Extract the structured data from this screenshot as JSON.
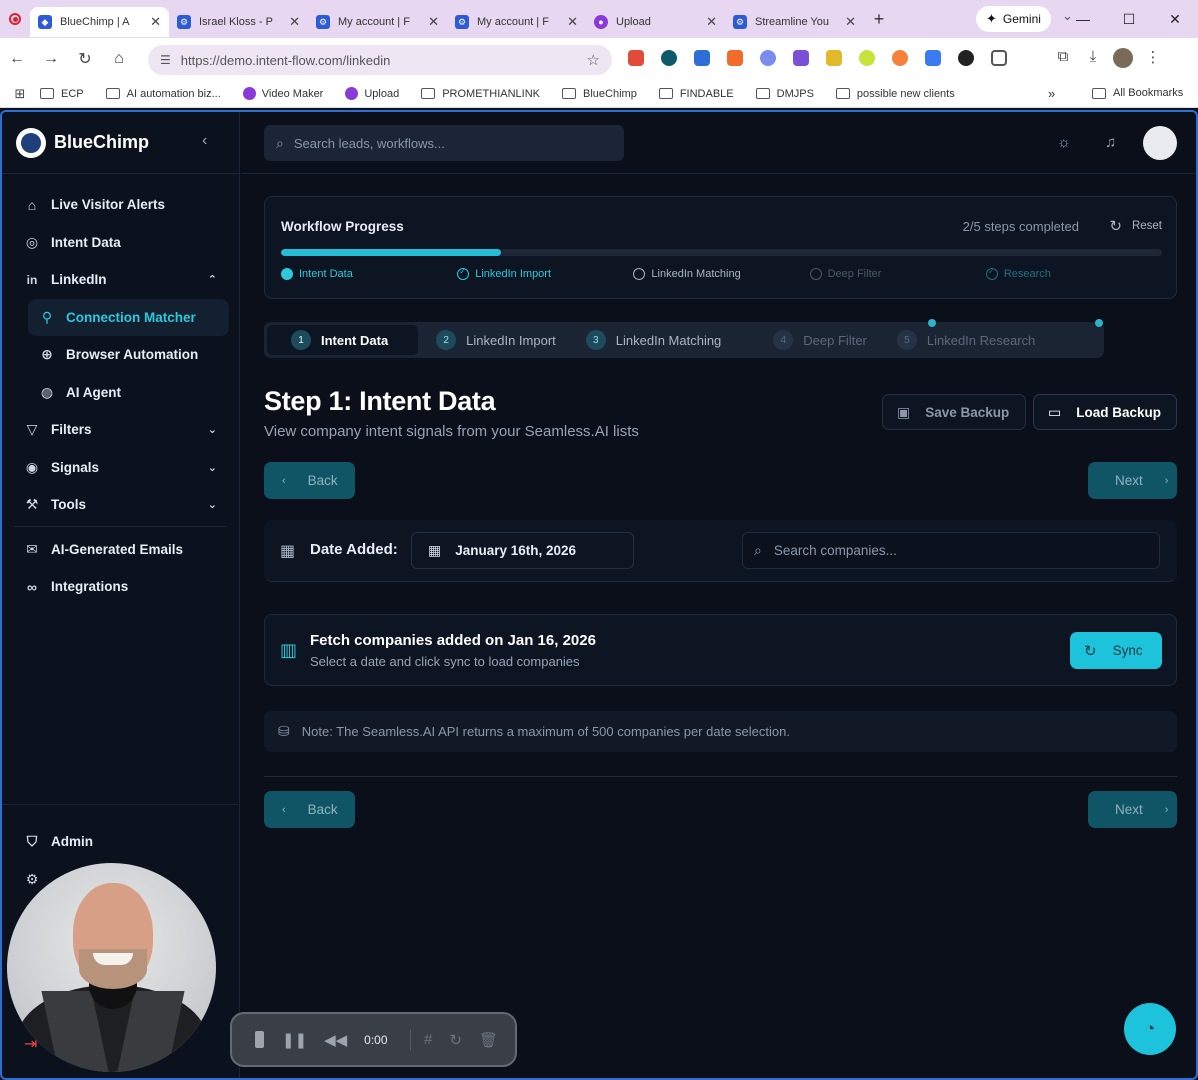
{
  "browser": {
    "tabs": [
      {
        "title": "BlueChimp | A",
        "active": true
      },
      {
        "title": "Israel Kloss - P",
        "active": false
      },
      {
        "title": "My account | F",
        "active": false
      },
      {
        "title": "My account | F",
        "active": false
      },
      {
        "title": "Upload",
        "active": false
      },
      {
        "title": "Streamline You",
        "active": false
      }
    ],
    "gemini_label": "Gemini",
    "url": "https://demo.intent-flow.com/linkedin",
    "bookmarks": [
      "ECP",
      "AI automation biz...",
      "Video Maker",
      "Upload",
      "PROMETHIANLINK",
      "BlueChimp",
      "FINDABLE",
      "DMJPS",
      "possible new clients"
    ],
    "all_bookmarks": "All Bookmarks"
  },
  "app": {
    "brand": "BlueChimp",
    "search_placeholder": "Search leads, workflows...",
    "nav": [
      {
        "label": "Live Visitor Alerts",
        "icon": "home-icon"
      },
      {
        "label": "Intent Data",
        "icon": "target-icon"
      },
      {
        "label": "LinkedIn",
        "icon": "linkedin-icon"
      },
      {
        "label": "Connection Matcher",
        "icon": "network-icon"
      },
      {
        "label": "Browser Automation",
        "icon": "globe-icon"
      },
      {
        "label": "AI Agent",
        "icon": "bot-icon"
      },
      {
        "label": "Filters",
        "icon": "filter-icon"
      },
      {
        "label": "Signals",
        "icon": "signal-icon"
      },
      {
        "label": "Tools",
        "icon": "wrench-icon"
      },
      {
        "label": "AI-Generated Emails",
        "icon": "mail-icon"
      },
      {
        "label": "Integrations",
        "icon": "link-icon"
      }
    ],
    "bottom_nav": [
      {
        "label": "Admin",
        "icon": "shield-icon"
      }
    ]
  },
  "workflow": {
    "title": "Workflow Progress",
    "steps_completed": "2/5 steps completed",
    "reset_label": "Reset",
    "progress_fraction": 0.25,
    "progress_steps": [
      "Intent Data",
      "LinkedIn Import",
      "LinkedIn Matching",
      "Deep Filter",
      "Research"
    ],
    "step_tabs": [
      {
        "num": "1",
        "label": "Intent Data"
      },
      {
        "num": "2",
        "label": "LinkedIn Import"
      },
      {
        "num": "3",
        "label": "LinkedIn Matching"
      },
      {
        "num": "4",
        "label": "Deep Filter"
      },
      {
        "num": "5",
        "label": "LinkedIn Research"
      }
    ]
  },
  "step": {
    "title": "Step 1: Intent Data",
    "subtitle": "View company intent signals from your Seamless.AI lists",
    "save_backup": "Save Backup",
    "load_backup": "Load Backup",
    "back": "Back",
    "next": "Next",
    "date_label": "Date Added:",
    "date_value": "January 16th, 2026",
    "company_search_placeholder": "Search companies...",
    "fetch_title": "Fetch companies added on Jan 16, 2026",
    "fetch_sub": "Select a date and click sync to load companies",
    "sync_label": "Sync",
    "note": "Note: The Seamless.AI API returns a maximum of 500 companies per date selection."
  },
  "recorder": {
    "time": "0:00"
  }
}
